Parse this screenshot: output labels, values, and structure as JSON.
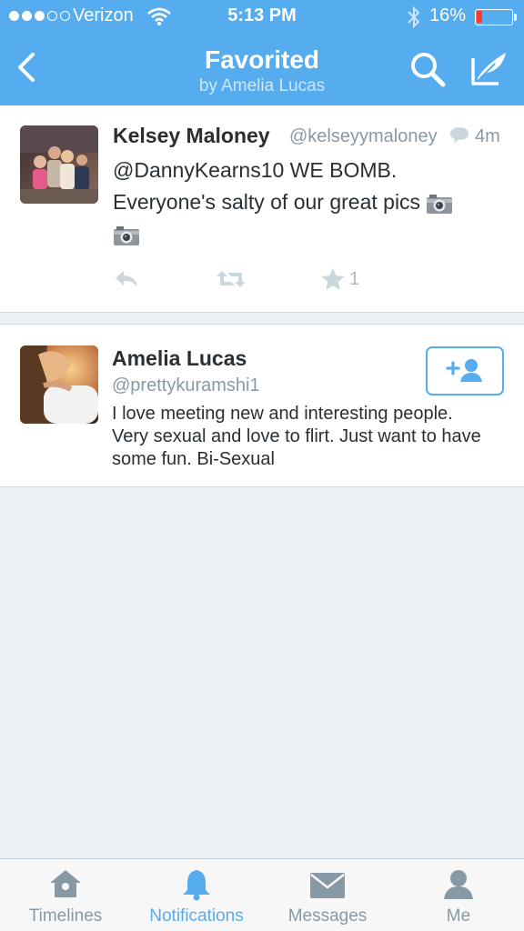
{
  "status_bar": {
    "carrier": "Verizon",
    "time": "5:13 PM",
    "battery_percent": "16%",
    "battery_level": 0.16,
    "signal_bars_filled": 3,
    "signal_bars_total": 5
  },
  "nav": {
    "title": "Favorited",
    "subtitle": "by Amelia Lucas"
  },
  "tweet": {
    "name": "Kelsey Maloney",
    "handle": "@kelseyymaloney",
    "time": "4m",
    "line1": "@DannyKearns10 WE BOMB.",
    "line2": "Everyone's salty of our great pics",
    "favorite_count": "1",
    "icons": [
      "reply-icon",
      "retweet-icon",
      "star-icon",
      "camera-icon",
      "conversation-icon"
    ]
  },
  "user": {
    "name": "Amelia Lucas",
    "handle": "@prettykuramshi1",
    "bio": "I love meeting new and interesting people. Very sexual and love to flirt. Just want to have some fun. Bi-Sexual"
  },
  "tabs": [
    {
      "label": "Timelines",
      "icon": "home-icon",
      "active": false
    },
    {
      "label": "Notifications",
      "icon": "bell-icon",
      "active": true
    },
    {
      "label": "Messages",
      "icon": "envelope-icon",
      "active": false
    },
    {
      "label": "Me",
      "icon": "person-icon",
      "active": false
    }
  ],
  "colors": {
    "brand": "#55acee",
    "background": "#eef1f4",
    "muted_text": "#8899a6",
    "battery_low": "#ff3b30"
  }
}
